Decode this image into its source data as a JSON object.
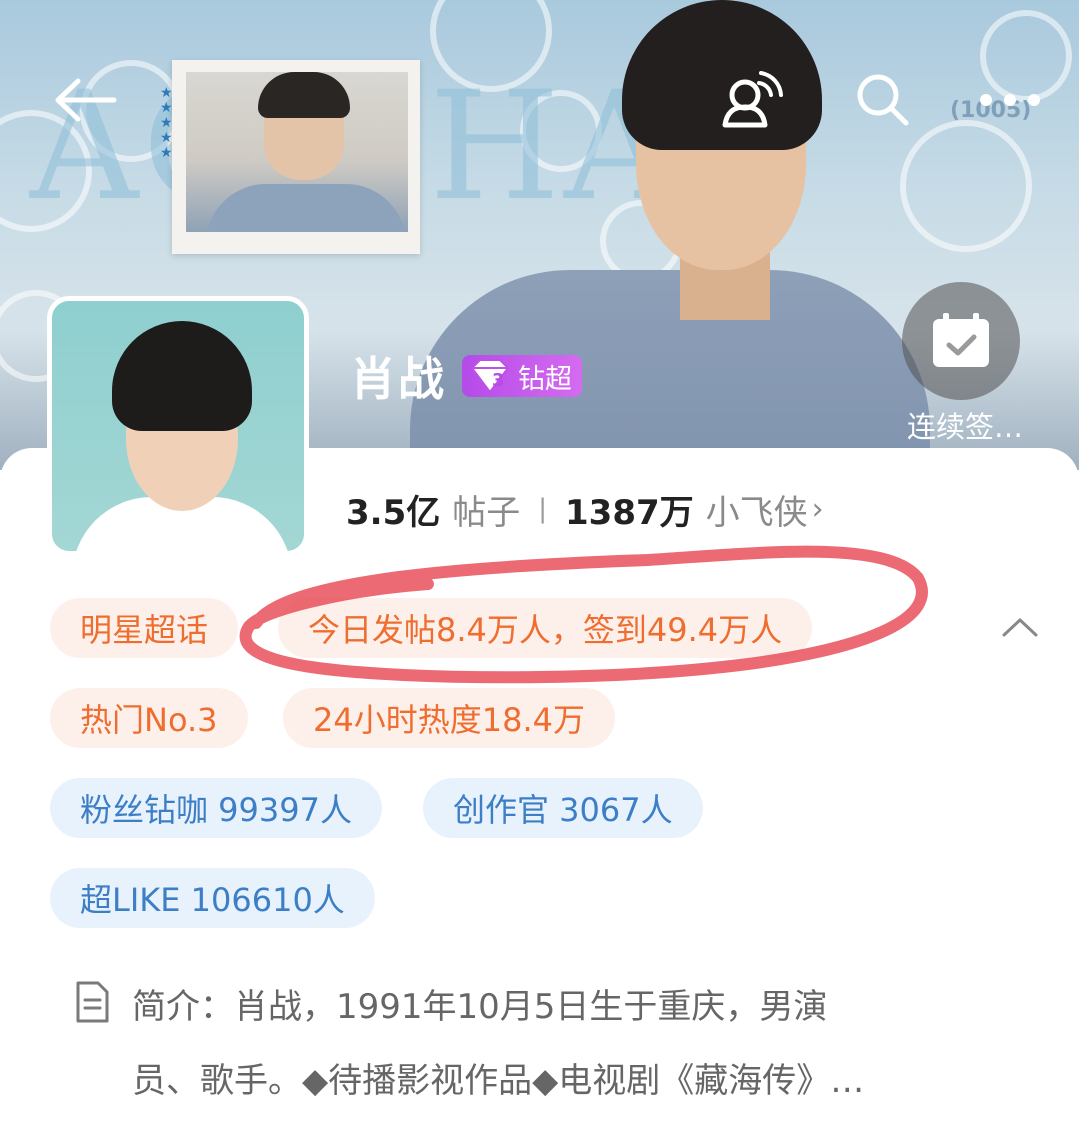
{
  "header": {
    "back_icon": "back-arrow-icon",
    "fans_icon": "fans-icon",
    "search_icon": "search-icon",
    "more_icon": "more-icon",
    "bg_text": "AO ZHAN",
    "tag_1005": "(1005)"
  },
  "topic": {
    "name": "肖战",
    "badge_label": "钻超",
    "badge_level": "3"
  },
  "checkin": {
    "label": "连续签…"
  },
  "stats": {
    "posts_value": "3.5亿",
    "posts_label": "帖子",
    "fans_value": "1387万",
    "fans_label": "小飞侠",
    "chevron": "›"
  },
  "chips": {
    "row1": [
      "明星超话",
      "今日发帖8.4万人，签到49.4万人"
    ],
    "row2": [
      "热门No.3",
      "24小时热度18.4万"
    ],
    "row3": [
      "粉丝钻咖 99397人",
      "创作官 3067人"
    ],
    "row4": [
      "超LIKE 106610人"
    ]
  },
  "intro": {
    "line1": "简介：肖战，1991年10月5日生于重庆，男演",
    "line2": "员、歌手。◆待播影视作品◆电视剧《藏海传》…"
  },
  "colors": {
    "chip_orange_text": "#ef6d2f",
    "chip_orange_bg": "#fdf0ea",
    "chip_blue_text": "#3d7fc6",
    "chip_blue_bg": "#e8f2fc",
    "badge_purple": "#b54be8",
    "annotation_red": "#e8505b"
  }
}
